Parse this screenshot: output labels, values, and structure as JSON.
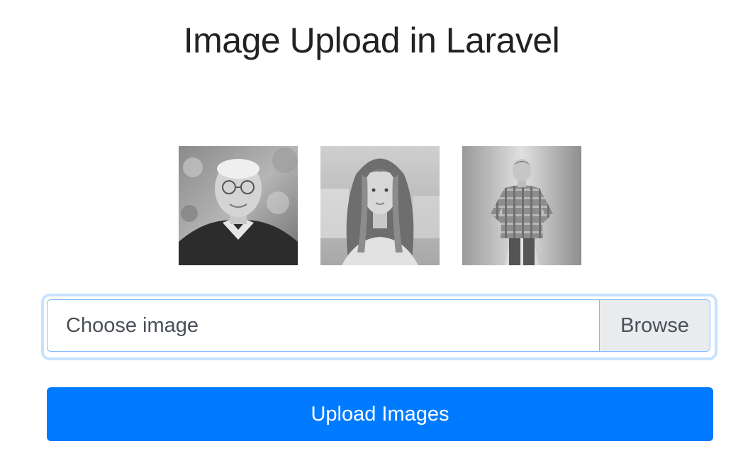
{
  "page": {
    "title": "Image Upload in Laravel"
  },
  "gallery": {
    "images": [
      {
        "alt": "elderly man portrait"
      },
      {
        "alt": "woman with long hair portrait"
      },
      {
        "alt": "man in plaid shirt portrait"
      }
    ]
  },
  "file_input": {
    "placeholder": "Choose image",
    "browse_label": "Browse"
  },
  "submit": {
    "label": "Upload Images"
  },
  "colors": {
    "primary": "#007bff",
    "focus_border": "#80bdff",
    "browse_bg": "#e9ecef",
    "text": "#495057"
  }
}
